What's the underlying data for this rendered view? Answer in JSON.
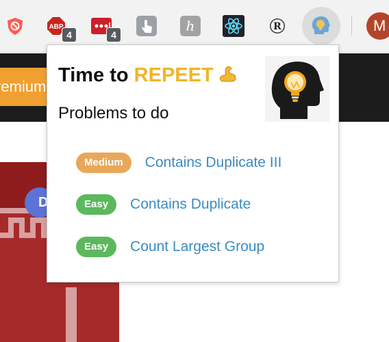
{
  "toolbar": {
    "extensions": [
      {
        "icon": "blocked-shield-icon"
      },
      {
        "icon": "adblock-icon",
        "badge": "4"
      },
      {
        "icon": "lastpass-icon",
        "badge": "4"
      },
      {
        "icon": "pointer-hand-icon"
      },
      {
        "icon": "h-extension-icon"
      },
      {
        "icon": "react-devtools-icon"
      },
      {
        "icon": "r-extension-icon"
      },
      {
        "icon": "repeet-extension-icon"
      }
    ],
    "avatar_letter": "M"
  },
  "background": {
    "premium_text": "remium",
    "bubble_letter": "D"
  },
  "popup": {
    "title_prefix": "Time to ",
    "title_accent": "REPEET",
    "subtitle": "Problems to do",
    "problems": [
      {
        "difficulty": "Medium",
        "name": "Contains Duplicate III",
        "color": "#e8a85a"
      },
      {
        "difficulty": "Easy",
        "name": "Contains Duplicate",
        "color": "#5cb85c"
      },
      {
        "difficulty": "Easy",
        "name": "Count Largest Group",
        "color": "#5cb85c"
      }
    ]
  },
  "colors": {
    "accent": "#f0b429",
    "link": "#3b8bc2",
    "medium": "#e8a85a",
    "easy": "#5cb85c"
  }
}
